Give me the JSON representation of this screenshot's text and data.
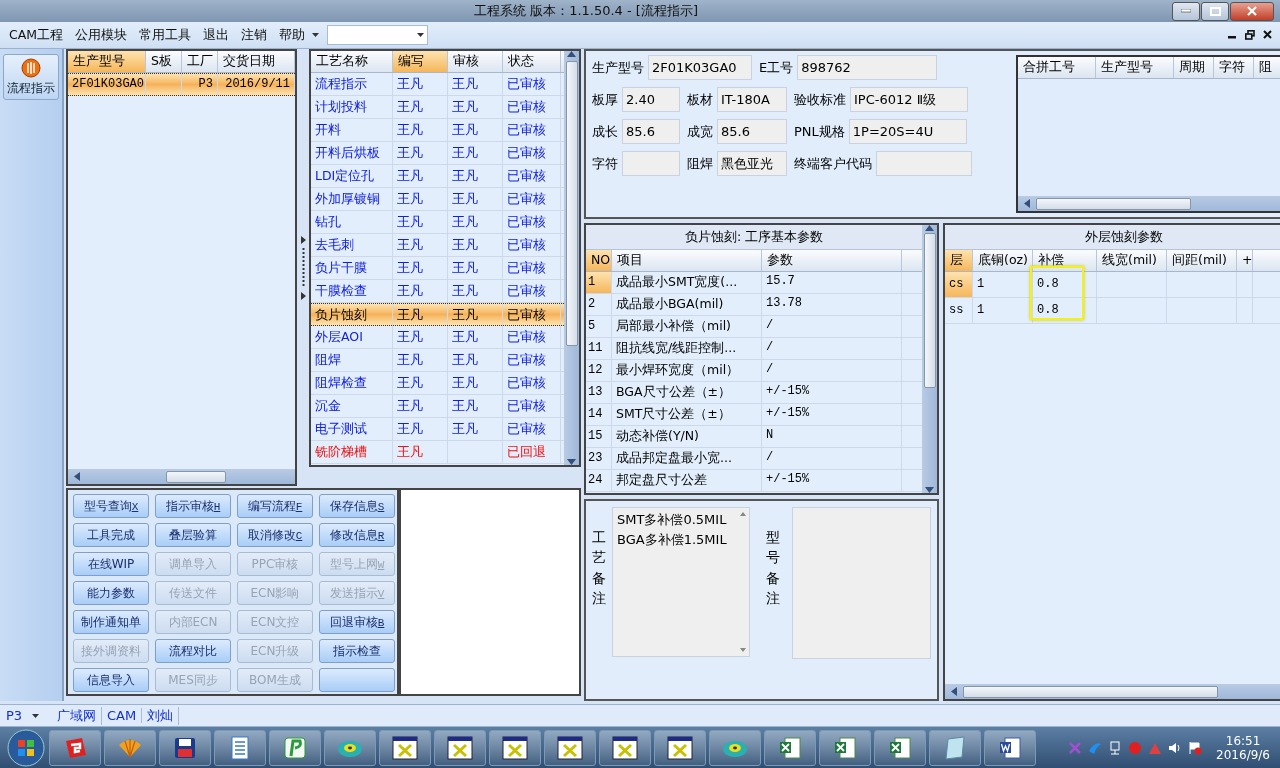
{
  "window": {
    "title": "工程系统  版本：1.1.50.4 - [流程指示]"
  },
  "menu": {
    "items": [
      "CAM工程",
      "公用模块",
      "常用工具",
      "退出",
      "注销",
      "帮助"
    ]
  },
  "side_toolbar": {
    "button": "流程指示"
  },
  "product_grid": {
    "columns": [
      {
        "label": "生产型号",
        "highlighted": true
      },
      {
        "label": "S板",
        "highlighted": false
      },
      {
        "label": "工厂",
        "highlighted": false
      },
      {
        "label": "交货日期",
        "highlighted": false
      }
    ],
    "rows": [
      {
        "cells": [
          "2F01K03GA0",
          "",
          "P3",
          "2016/9/11"
        ],
        "selected": true
      }
    ]
  },
  "process_grid": {
    "columns": [
      {
        "label": "工艺名称",
        "highlighted": false
      },
      {
        "label": "编写",
        "highlighted": true
      },
      {
        "label": "审核",
        "highlighted": false
      },
      {
        "label": "状态",
        "highlighted": false
      }
    ],
    "rows": [
      {
        "name": "流程指示",
        "writer": "王凡",
        "reviewer": "王凡",
        "status": "已审核",
        "selected": false,
        "returned": false
      },
      {
        "name": "计划投料",
        "writer": "王凡",
        "reviewer": "王凡",
        "status": "已审核",
        "selected": false,
        "returned": false
      },
      {
        "name": "开料",
        "writer": "王凡",
        "reviewer": "王凡",
        "status": "已审核",
        "selected": false,
        "returned": false
      },
      {
        "name": "开料后烘板",
        "writer": "王凡",
        "reviewer": "王凡",
        "status": "已审核",
        "selected": false,
        "returned": false
      },
      {
        "name": "LDI定位孔",
        "writer": "王凡",
        "reviewer": "王凡",
        "status": "已审核",
        "selected": false,
        "returned": false
      },
      {
        "name": "外加厚镀铜",
        "writer": "王凡",
        "reviewer": "王凡",
        "status": "已审核",
        "selected": false,
        "returned": false
      },
      {
        "name": "钻孔",
        "writer": "王凡",
        "reviewer": "王凡",
        "status": "已审核",
        "selected": false,
        "returned": false
      },
      {
        "name": "去毛刺",
        "writer": "王凡",
        "reviewer": "王凡",
        "status": "已审核",
        "selected": false,
        "returned": false
      },
      {
        "name": "负片干膜",
        "writer": "王凡",
        "reviewer": "王凡",
        "status": "已审核",
        "selected": false,
        "returned": false
      },
      {
        "name": "干膜检查",
        "writer": "王凡",
        "reviewer": "王凡",
        "status": "已审核",
        "selected": false,
        "returned": false
      },
      {
        "name": "负片蚀刻",
        "writer": "王凡",
        "reviewer": "王凡",
        "status": "已审核",
        "selected": true,
        "returned": false
      },
      {
        "name": "外层AOI",
        "writer": "王凡",
        "reviewer": "王凡",
        "status": "已审核",
        "selected": false,
        "returned": false
      },
      {
        "name": "阻焊",
        "writer": "王凡",
        "reviewer": "王凡",
        "status": "已审核",
        "selected": false,
        "returned": false
      },
      {
        "name": "阻焊检查",
        "writer": "王凡",
        "reviewer": "王凡",
        "status": "已审核",
        "selected": false,
        "returned": false
      },
      {
        "name": "沉金",
        "writer": "王凡",
        "reviewer": "王凡",
        "status": "已审核",
        "selected": false,
        "returned": false
      },
      {
        "name": "电子测试",
        "writer": "王凡",
        "reviewer": "王凡",
        "status": "已审核",
        "selected": false,
        "returned": false
      },
      {
        "name": "铣阶梯槽",
        "writer": "王凡",
        "status": "已回退",
        "selected": false,
        "returned": true
      }
    ]
  },
  "buttons": [
    {
      "label": "型号查询",
      "hotkey": "X",
      "enabled": true
    },
    {
      "label": "指示审核",
      "hotkey": "H",
      "enabled": true
    },
    {
      "label": "编写流程",
      "hotkey": "F",
      "enabled": true
    },
    {
      "label": "保存信息",
      "hotkey": "S",
      "enabled": true
    },
    {
      "label": "工具完成",
      "enabled": true
    },
    {
      "label": "叠层验算",
      "enabled": true
    },
    {
      "label": "取消修改",
      "hotkey": "C",
      "enabled": true
    },
    {
      "label": "修改信息",
      "hotkey": "R",
      "enabled": true
    },
    {
      "label": "在线WIP",
      "enabled": true
    },
    {
      "label": "调单导入",
      "enabled": false
    },
    {
      "label": "PPC审核",
      "enabled": false
    },
    {
      "label": "型号上网",
      "hotkey": "W",
      "enabled": false
    },
    {
      "label": "能力参数",
      "enabled": true
    },
    {
      "label": "传送文件",
      "enabled": false
    },
    {
      "label": "ECN影响",
      "enabled": false
    },
    {
      "label": "发送指示",
      "hotkey": "V",
      "enabled": false
    },
    {
      "label": "制作通知单",
      "enabled": true
    },
    {
      "label": "内部ECN",
      "enabled": false
    },
    {
      "label": "ECN文控",
      "enabled": false
    },
    {
      "label": "回退审核",
      "hotkey": "B",
      "enabled": true
    },
    {
      "label": "接外调资料",
      "enabled": false
    },
    {
      "label": "流程对比",
      "enabled": true
    },
    {
      "label": "ECN升级",
      "enabled": false
    },
    {
      "label": "指示检查",
      "enabled": true
    },
    {
      "label": "信息导入",
      "enabled": true
    },
    {
      "label": "MES同步",
      "enabled": false
    },
    {
      "label": "BOM生成",
      "enabled": false
    },
    {
      "enabled": true
    }
  ],
  "info_form": {
    "rows": [
      [
        {
          "label": "生产型号",
          "value": "2F01K03GA0"
        },
        {
          "label": "E工号",
          "value": "898762"
        }
      ],
      [
        {
          "label": "板厚",
          "value": "2.40"
        },
        {
          "label": "板材",
          "value": "IT-180A"
        },
        {
          "label": "验收标准",
          "value": "IPC-6012 Ⅱ级"
        }
      ],
      [
        {
          "label": "成长",
          "value": "85.6"
        },
        {
          "label": "成宽",
          "value": "85.6"
        },
        {
          "label": "PNL规格",
          "value": "1P=20S=4U"
        }
      ],
      [
        {
          "label": "字符"
        },
        {
          "label": "阻焊",
          "value": "黑色亚光"
        },
        {
          "label": "终端客户代码"
        }
      ]
    ]
  },
  "combine_grid": {
    "columns": [
      "合拼工号",
      "生产型号",
      "周期",
      "字符",
      "阻"
    ]
  },
  "param_table": {
    "title": "负片蚀刻: 工序基本参数",
    "columns": [
      {
        "label": "NO",
        "highlighted": true
      },
      {
        "label": "项目",
        "highlighted": false
      },
      {
        "label": "参数",
        "highlighted": false
      }
    ],
    "rows": [
      {
        "no": "1",
        "item": "成品最小SMT宽度(...",
        "value": "15.7",
        "selected": true
      },
      {
        "no": "2",
        "item": "成品最小BGA(mil)",
        "value": "13.78",
        "selected": false
      },
      {
        "no": "5",
        "item": "局部最小补偿（mil)",
        "value": "/",
        "selected": false
      },
      {
        "no": "11",
        "item": "阻抗线宽/线距控制...",
        "value": "/",
        "selected": false
      },
      {
        "no": "12",
        "item": "最小焊环宽度（mil）",
        "value": "/",
        "selected": false
      },
      {
        "no": "13",
        "item": "BGA尺寸公差（±）",
        "value": "+/-15%",
        "selected": false
      },
      {
        "no": "14",
        "item": "SMT尺寸公差（±）",
        "value": "+/-15%",
        "selected": false
      },
      {
        "no": "15",
        "item": "动态补偿(Y/N)",
        "value": "N",
        "selected": false
      },
      {
        "no": "23",
        "item": "成品邦定盘最小宽...",
        "value": "/",
        "selected": false
      },
      {
        "no": "24",
        "item": "邦定盘尺寸公差",
        "value": "+/-15%",
        "selected": false
      }
    ]
  },
  "outer_table": {
    "title": "外层蚀刻参数",
    "columns": [
      {
        "label": "层",
        "highlighted": true
      },
      {
        "label": "底铜(oz)",
        "highlighted": false
      },
      {
        "label": "补偿",
        "highlighted": false
      },
      {
        "label": "线宽(mil)",
        "highlighted": false
      },
      {
        "label": "间距(mil)",
        "highlighted": false
      },
      {
        "label": "+",
        "highlighted": false
      }
    ],
    "rows": [
      {
        "cells": [
          "cs",
          "1",
          "0.8"
        ],
        "selected": true
      },
      {
        "cells": [
          "ss",
          "1",
          "0.8"
        ],
        "selected": false
      }
    ]
  },
  "remarks": {
    "process_label": "工艺备注",
    "process_lines": [
      "SMT多补偿0.5MIL",
      "BGA多补偿1.5MIL"
    ],
    "model_label": "型号备注"
  },
  "status_bar": {
    "factory": "P3",
    "items": [
      "广域网",
      "CAM",
      "刘灿"
    ]
  },
  "taskbar": {
    "time": "16:51",
    "date": "2016/9/6"
  }
}
